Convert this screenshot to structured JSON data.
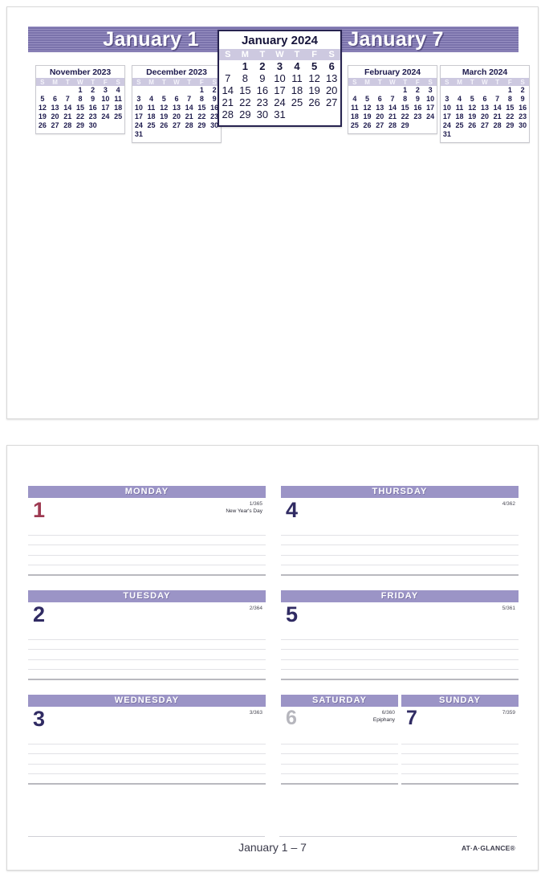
{
  "document": {
    "brand": "AT·A·GLANCE®",
    "accent_purple": "#8178b4",
    "header_purple": "#9b94c6",
    "weekday_navy": "#302b63",
    "holiday_red": "#9e3a52",
    "muted_gray": "#b6b6bd"
  },
  "reference_page": {
    "banner": {
      "left_title": "January 1",
      "right_title": "January 7"
    },
    "featured_month": {
      "title": "January 2024",
      "weekday_headers": [
        "S",
        "M",
        "T",
        "W",
        "T",
        "F",
        "S"
      ],
      "lead_blanks": 1,
      "days_in_month": 31,
      "bold_days": [
        1,
        2,
        3,
        4,
        5,
        6
      ],
      "weeks": [
        [
          "",
          "1",
          "2",
          "3",
          "4",
          "5",
          "6"
        ],
        [
          "7",
          "8",
          "9",
          "10",
          "11",
          "12",
          "13"
        ],
        [
          "14",
          "15",
          "16",
          "17",
          "18",
          "19",
          "20"
        ],
        [
          "21",
          "22",
          "23",
          "24",
          "25",
          "26",
          "27"
        ],
        [
          "28",
          "29",
          "30",
          "31",
          "",
          "",
          ""
        ]
      ]
    },
    "mini_months": [
      {
        "title": "November 2023",
        "weekday_headers": [
          "S",
          "M",
          "T",
          "W",
          "T",
          "F",
          "S"
        ],
        "weeks": [
          [
            "",
            "",
            "",
            "1",
            "2",
            "3",
            "4"
          ],
          [
            "5",
            "6",
            "7",
            "8",
            "9",
            "10",
            "11"
          ],
          [
            "12",
            "13",
            "14",
            "15",
            "16",
            "17",
            "18"
          ],
          [
            "19",
            "20",
            "21",
            "22",
            "23",
            "24",
            "25"
          ],
          [
            "26",
            "27",
            "28",
            "29",
            "30",
            "",
            ""
          ]
        ]
      },
      {
        "title": "December 2023",
        "weekday_headers": [
          "S",
          "M",
          "T",
          "W",
          "T",
          "F",
          "S"
        ],
        "weeks": [
          [
            "",
            "",
            "",
            "",
            "",
            "1",
            "2"
          ],
          [
            "3",
            "4",
            "5",
            "6",
            "7",
            "8",
            "9"
          ],
          [
            "10",
            "11",
            "12",
            "13",
            "14",
            "15",
            "16"
          ],
          [
            "17",
            "18",
            "19",
            "20",
            "21",
            "22",
            "23"
          ],
          [
            "24",
            "25",
            "26",
            "27",
            "28",
            "29",
            "30"
          ],
          [
            "31",
            "",
            "",
            "",
            "",
            "",
            ""
          ]
        ]
      },
      {
        "title": "February 2024",
        "weekday_headers": [
          "S",
          "M",
          "T",
          "W",
          "T",
          "F",
          "S"
        ],
        "weeks": [
          [
            "",
            "",
            "",
            "",
            "1",
            "2",
            "3"
          ],
          [
            "4",
            "5",
            "6",
            "7",
            "8",
            "9",
            "10"
          ],
          [
            "11",
            "12",
            "13",
            "14",
            "15",
            "16",
            "17"
          ],
          [
            "18",
            "19",
            "20",
            "21",
            "22",
            "23",
            "24"
          ],
          [
            "25",
            "26",
            "27",
            "28",
            "29",
            "",
            ""
          ]
        ]
      },
      {
        "title": "March 2024",
        "weekday_headers": [
          "S",
          "M",
          "T",
          "W",
          "T",
          "F",
          "S"
        ],
        "weeks": [
          [
            "",
            "",
            "",
            "",
            "",
            "1",
            "2"
          ],
          [
            "3",
            "4",
            "5",
            "6",
            "7",
            "8",
            "9"
          ],
          [
            "10",
            "11",
            "12",
            "13",
            "14",
            "15",
            "16"
          ],
          [
            "17",
            "18",
            "19",
            "20",
            "21",
            "22",
            "23"
          ],
          [
            "24",
            "25",
            "26",
            "27",
            "28",
            "29",
            "30"
          ],
          [
            "31",
            "",
            "",
            "",
            "",
            "",
            ""
          ]
        ]
      }
    ]
  },
  "planner_page": {
    "rules_per_day": 5,
    "footer": {
      "range": "January 1 – 7",
      "brand": "AT·A·GLANCE®"
    },
    "days": {
      "monday": {
        "name": "MONDAY",
        "number": "1",
        "count": "1/365",
        "event": "New Year's Day",
        "style": "holiday"
      },
      "tuesday": {
        "name": "TUESDAY",
        "number": "2",
        "count": "2/364",
        "event": "",
        "style": "weekday"
      },
      "wednesday": {
        "name": "WEDNESDAY",
        "number": "3",
        "count": "3/363",
        "event": "",
        "style": "weekday"
      },
      "thursday": {
        "name": "THURSDAY",
        "number": "4",
        "count": "4/362",
        "event": "",
        "style": "weekday"
      },
      "friday": {
        "name": "FRIDAY",
        "number": "5",
        "count": "5/361",
        "event": "",
        "style": "weekday"
      },
      "saturday": {
        "name": "SATURDAY",
        "number": "6",
        "count": "6/360",
        "event": "Epiphany",
        "style": "muted"
      },
      "sunday": {
        "name": "SUNDAY",
        "number": "7",
        "count": "7/359",
        "event": "",
        "style": "weekday"
      }
    }
  }
}
